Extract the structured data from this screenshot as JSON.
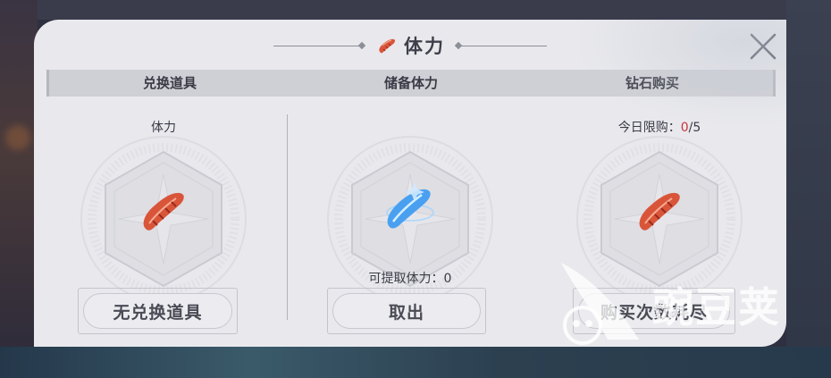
{
  "dialog": {
    "title": "体力",
    "title_icon": "sausage-icon",
    "close_icon": "close-x-icon"
  },
  "columns": [
    {
      "header": "兑换道具",
      "top_label": "体力",
      "item_icon": "sausage-icon",
      "button_label": "无兑换道具"
    },
    {
      "header": "储备体力",
      "item_icon": "blue-crystal-sausage-icon",
      "extract_prefix": "可提取体力：",
      "extract_value": "0",
      "button_label": "取出"
    },
    {
      "header": "钻石购买",
      "limit_prefix": "今日限购：",
      "limit_used": "0",
      "limit_total": "/5",
      "item_icon": "sausage-icon",
      "button_label": "购买次数耗尽"
    }
  ],
  "watermark": {
    "text": "豌豆荚",
    "logo_icon": "wandoujia-logo-icon"
  },
  "colors": {
    "panel_bg": "#e9e9ed",
    "header_bar": "#cfd0d5",
    "text_dark": "#3a3b46",
    "limit_red": "#c8343a",
    "sausage": "#d9553a",
    "crystal_blue": "#4aa0f0"
  }
}
